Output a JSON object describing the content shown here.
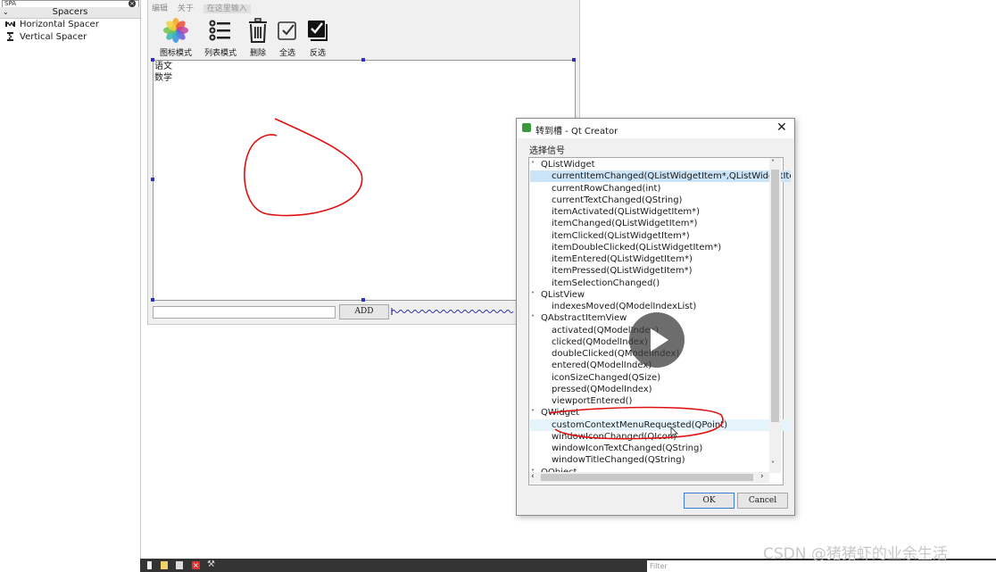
{
  "widget_box": {
    "filter_text": "SPA",
    "category": "Spacers",
    "items": [
      {
        "label": "Horizontal Spacer",
        "icon": "horizontal-spacer-icon"
      },
      {
        "label": "Vertical Spacer",
        "icon": "vertical-spacer-icon"
      }
    ]
  },
  "form": {
    "menus": [
      "编辑",
      "关于"
    ],
    "menu_hint": "在这里输入",
    "toolbar": [
      {
        "label": "图标模式",
        "icon": "photos-icon"
      },
      {
        "label": "列表模式",
        "icon": "list-icon"
      },
      {
        "label": "删除",
        "icon": "trash-icon"
      },
      {
        "label": "全选",
        "icon": "checkbox-checked-icon"
      },
      {
        "label": "反选",
        "icon": "checkbox-inverted-icon"
      }
    ],
    "list_items": [
      "语文",
      "数学"
    ],
    "add_button": "ADD"
  },
  "bottom": {
    "filter_placeholder": "Filter",
    "watermark": "CSDN @猪猪虾的业余生活"
  },
  "dialog": {
    "title": "转到槽 - Qt Creator",
    "close": "✕",
    "label": "选择信号",
    "ok": "OK",
    "cancel": "Cancel",
    "tree": [
      {
        "kind": "group",
        "text": "QListWidget"
      },
      {
        "kind": "child",
        "text": "currentItemChanged(QListWidgetItem*,QListWidgetItem*)",
        "state": "selected"
      },
      {
        "kind": "child",
        "text": "currentRowChanged(int)"
      },
      {
        "kind": "child",
        "text": "currentTextChanged(QString)"
      },
      {
        "kind": "child",
        "text": "itemActivated(QListWidgetItem*)"
      },
      {
        "kind": "child",
        "text": "itemChanged(QListWidgetItem*)"
      },
      {
        "kind": "child",
        "text": "itemClicked(QListWidgetItem*)"
      },
      {
        "kind": "child",
        "text": "itemDoubleClicked(QListWidgetItem*)"
      },
      {
        "kind": "child",
        "text": "itemEntered(QListWidgetItem*)"
      },
      {
        "kind": "child",
        "text": "itemPressed(QListWidgetItem*)"
      },
      {
        "kind": "child",
        "text": "itemSelectionChanged()"
      },
      {
        "kind": "group",
        "text": "QListView"
      },
      {
        "kind": "child",
        "text": "indexesMoved(QModelIndexList)"
      },
      {
        "kind": "group",
        "text": "QAbstractItemView"
      },
      {
        "kind": "child",
        "text": "activated(QModelIndex)"
      },
      {
        "kind": "child",
        "text": "clicked(QModelIndex)"
      },
      {
        "kind": "child",
        "text": "doubleClicked(QModelIndex)"
      },
      {
        "kind": "child",
        "text": "entered(QModelIndex)"
      },
      {
        "kind": "child",
        "text": "iconSizeChanged(QSize)"
      },
      {
        "kind": "child",
        "text": "pressed(QModelIndex)"
      },
      {
        "kind": "child",
        "text": "viewportEntered()"
      },
      {
        "kind": "group",
        "text": "QWidget"
      },
      {
        "kind": "child",
        "text": "customContextMenuRequested(QPoint)",
        "state": "hover"
      },
      {
        "kind": "child",
        "text": "windowIconChanged(QIcon)"
      },
      {
        "kind": "child",
        "text": "windowIconTextChanged(QString)"
      },
      {
        "kind": "child",
        "text": "windowTitleChanged(QString)"
      },
      {
        "kind": "group",
        "text": "QObject"
      }
    ]
  },
  "colors": {
    "selection": "#cce4f7",
    "annotation": "#e01010",
    "handle": "#3030c0"
  }
}
